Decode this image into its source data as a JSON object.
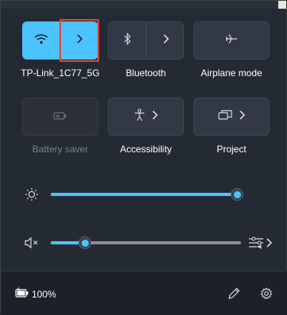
{
  "tiles": {
    "wifi": {
      "label": "TP-Link_1C77_5G",
      "icon": "wifi-icon",
      "active": true
    },
    "bluetooth": {
      "label": "Bluetooth",
      "icon": "bluetooth-icon",
      "active": false
    },
    "airplane": {
      "label": "Airplane mode",
      "icon": "airplane-icon",
      "active": false
    },
    "battery_saver": {
      "label": "Battery saver",
      "icon": "battery-saver-icon",
      "enabled": false
    },
    "accessibility": {
      "label": "Accessibility",
      "icon": "accessibility-icon"
    },
    "project": {
      "label": "Project",
      "icon": "project-icon"
    }
  },
  "brightness": {
    "icon": "brightness-icon",
    "level": 0.98
  },
  "volume": {
    "icon": "speaker-muted-icon",
    "level": 0.18,
    "output_icon": "audio-output-icon"
  },
  "footer": {
    "battery_percent": "100%",
    "battery_icon": "battery-charging-icon",
    "edit_icon": "pencil-icon",
    "settings_icon": "gear-icon"
  },
  "colors": {
    "accent": "#4cc2ff",
    "highlight": "#e0463f",
    "panel": "#242a34"
  }
}
